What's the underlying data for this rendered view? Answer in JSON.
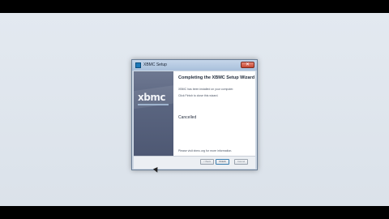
{
  "window": {
    "title": "XBMC Setup",
    "close_label": "✕"
  },
  "banner": {
    "logo_text": "xbmc",
    "logo_color": "#f2f4f8",
    "background_color": "#5a6580"
  },
  "wizard": {
    "heading": "Completing the XBMC Setup Wizard",
    "line1": "XBMC has been installed on your computer.",
    "line2": "Click Finish to close this wizard.",
    "status": "Cancelled",
    "footer_text": "Please visit xbmc.org for more information."
  },
  "buttons": {
    "back": "< Back",
    "finish": "Finish",
    "cancel": "Cancel"
  },
  "colors": {
    "accent": "#3c7fb1"
  }
}
